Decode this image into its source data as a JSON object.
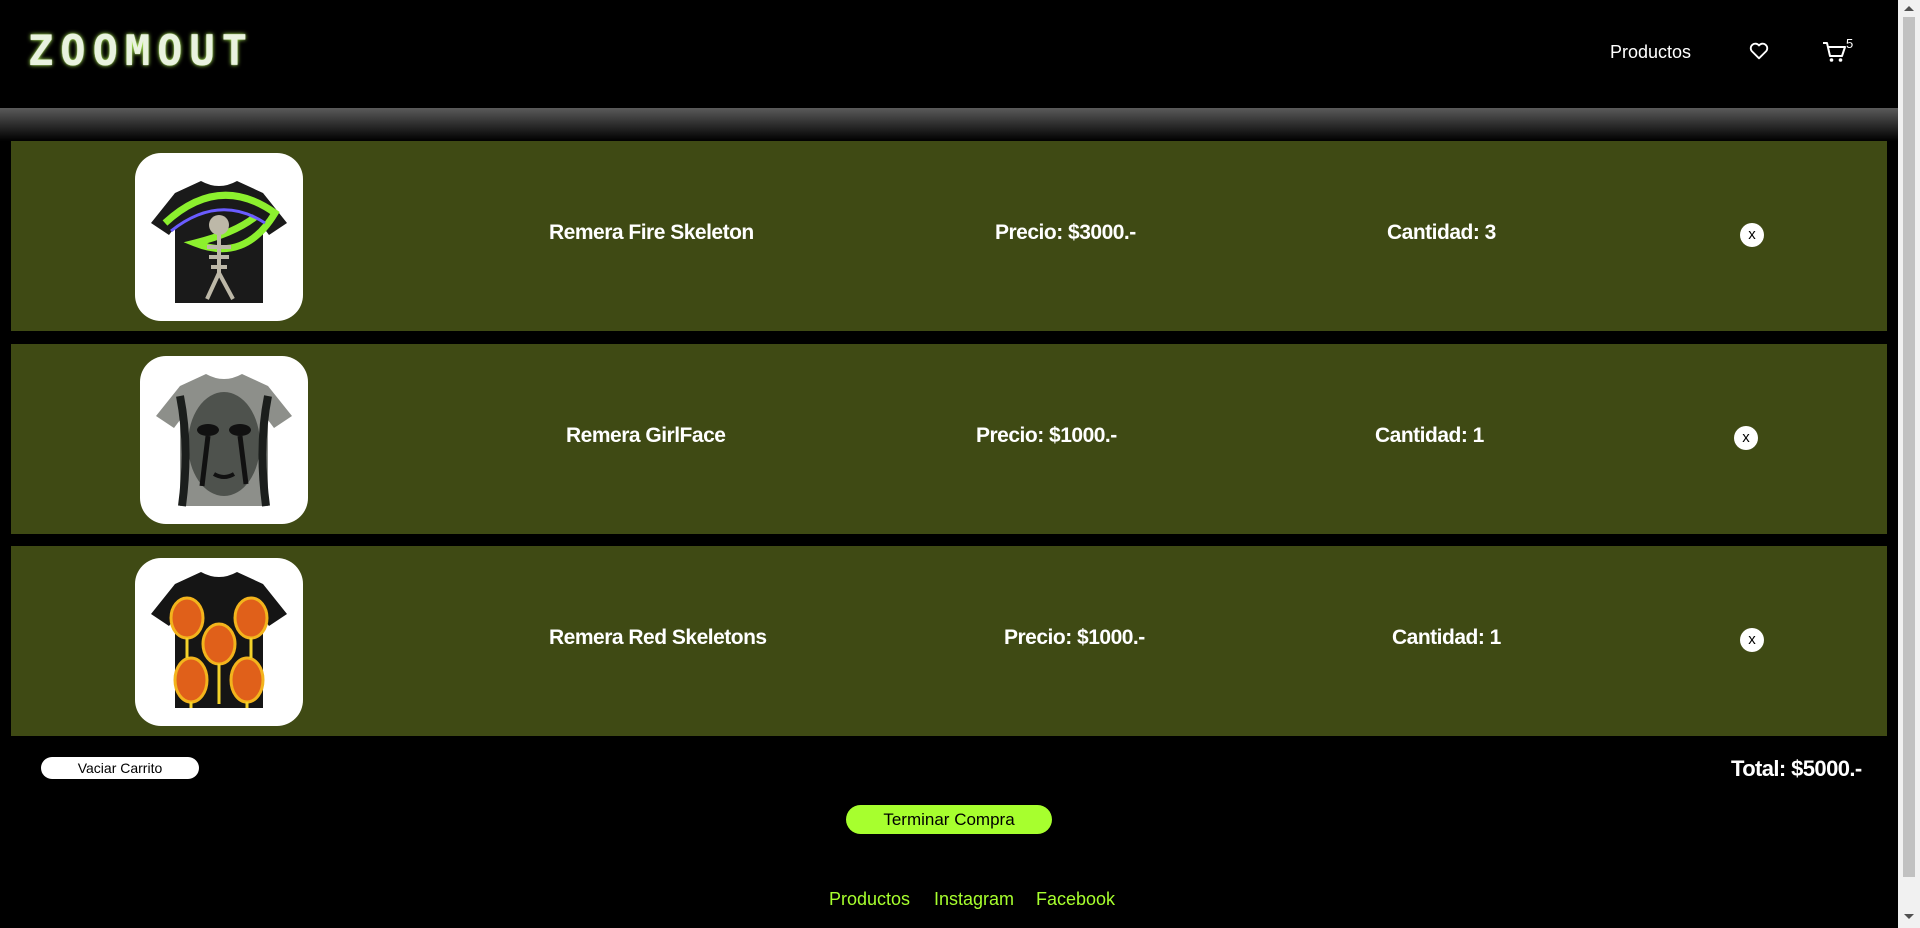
{
  "header": {
    "logo": "ZOOMOUT",
    "nav_products": "Productos",
    "favorites_icon": "heart-icon",
    "cart_icon": "cart-icon",
    "cart_count": "5"
  },
  "cart": {
    "items": [
      {
        "name": "Remera Fire Skeleton",
        "price": "Precio: $3000.-",
        "quantity": "Cantidad: 3",
        "remove": "x",
        "image": "fire-skeleton-tshirt"
      },
      {
        "name": "Remera GirlFace",
        "price": "Precio: $1000.-",
        "quantity": "Cantidad: 1",
        "remove": "x",
        "image": "girlface-tshirt"
      },
      {
        "name": "Remera Red Skeletons",
        "price": "Precio: $1000.-",
        "quantity": "Cantidad: 1",
        "remove": "x",
        "image": "red-skeletons-tshirt"
      }
    ],
    "clear_label": "Vaciar Carrito",
    "total": "Total: $5000.-",
    "checkout_label": "Terminar Compra"
  },
  "footer": {
    "links": [
      "Productos",
      "Instagram",
      "Facebook"
    ]
  },
  "colors": {
    "background": "#000000",
    "row_background": "#3f4a14",
    "accent": "#a7ff2e"
  }
}
